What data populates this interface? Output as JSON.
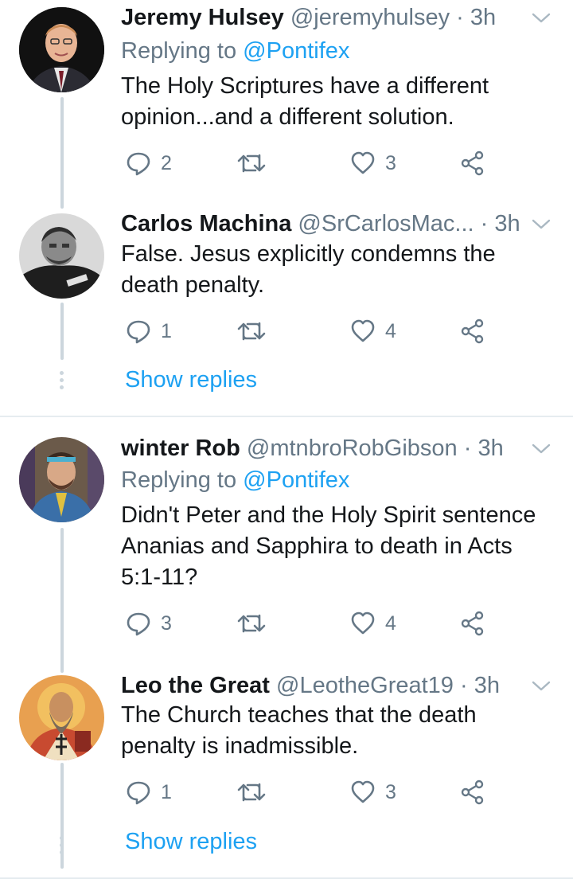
{
  "tweets": [
    {
      "name": "Jeremy Hulsey",
      "handle": "@jeremyhulsey",
      "time": "3h",
      "replying_prefix": "Replying to",
      "replying_to": "@Pontifex",
      "text": "The Holy Scriptures have a different opinion...and a different solution.",
      "replies": "2",
      "retweets": "",
      "likes": "3",
      "avatar_icon": "man-in-suit-avatar"
    },
    {
      "name": "Carlos Machina",
      "handle": "@SrCarlosMac...",
      "time": "3h",
      "text": "False.  Jesus explicitly condemns the death penalty.",
      "replies": "1",
      "retweets": "",
      "likes": "4",
      "avatar_icon": "bw-portrait-avatar"
    },
    {
      "name": "winter Rob",
      "handle": "@mtnbroRobGibson",
      "time": "3h",
      "replying_prefix": "Replying to",
      "replying_to": "@Pontifex",
      "text": "Didn't Peter and the Holy Spirit sentence Ananias and Sapphira to death in Acts 5:1-11?",
      "replies": "3",
      "retweets": "",
      "likes": "4",
      "avatar_icon": "outdoor-man-avatar"
    },
    {
      "name": "Leo the Great",
      "handle": "@LeotheGreat19",
      "time": "3h",
      "text": "The Church teaches that the death penalty is inadmissible.",
      "replies": "1",
      "retweets": "",
      "likes": "3",
      "avatar_icon": "icon-saint-avatar"
    }
  ],
  "separator": "·",
  "show_replies_label": "Show replies",
  "colors": {
    "accent": "#1da1f2",
    "muted": "#657786",
    "line": "#ccd6dd"
  }
}
